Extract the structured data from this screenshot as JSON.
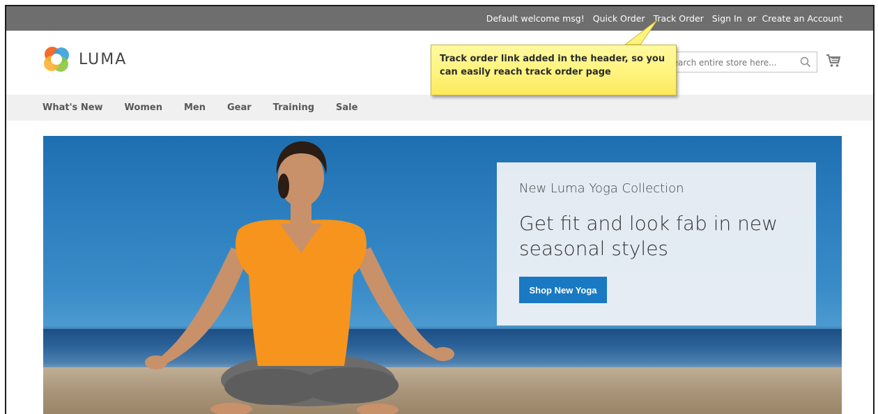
{
  "topbar": {
    "welcome": "Default welcome msg!",
    "quick_order": "Quick Order",
    "track_order": "Track Order",
    "sign_in": "Sign In",
    "or": "or",
    "create_account": "Create an Account"
  },
  "header": {
    "logo_text": "LUMA",
    "search_placeholder": "Search entire store here...",
    "search_icon": "search-icon",
    "cart_icon": "cart-icon"
  },
  "nav": {
    "items": [
      "What's New",
      "Women",
      "Men",
      "Gear",
      "Training",
      "Sale"
    ]
  },
  "hero": {
    "subtitle": "New Luma Yoga Collection",
    "headline": "Get fit and look fab in new seasonal styles",
    "button_label": "Shop New Yoga"
  },
  "callout": {
    "text": "Track order link added in the header, so you can easily reach track order page"
  },
  "colors": {
    "topbar": "#6e6e6e",
    "nav_bg": "#f0f0f0",
    "primary_button": "#1979c3",
    "callout_bg": "#fff37a"
  }
}
